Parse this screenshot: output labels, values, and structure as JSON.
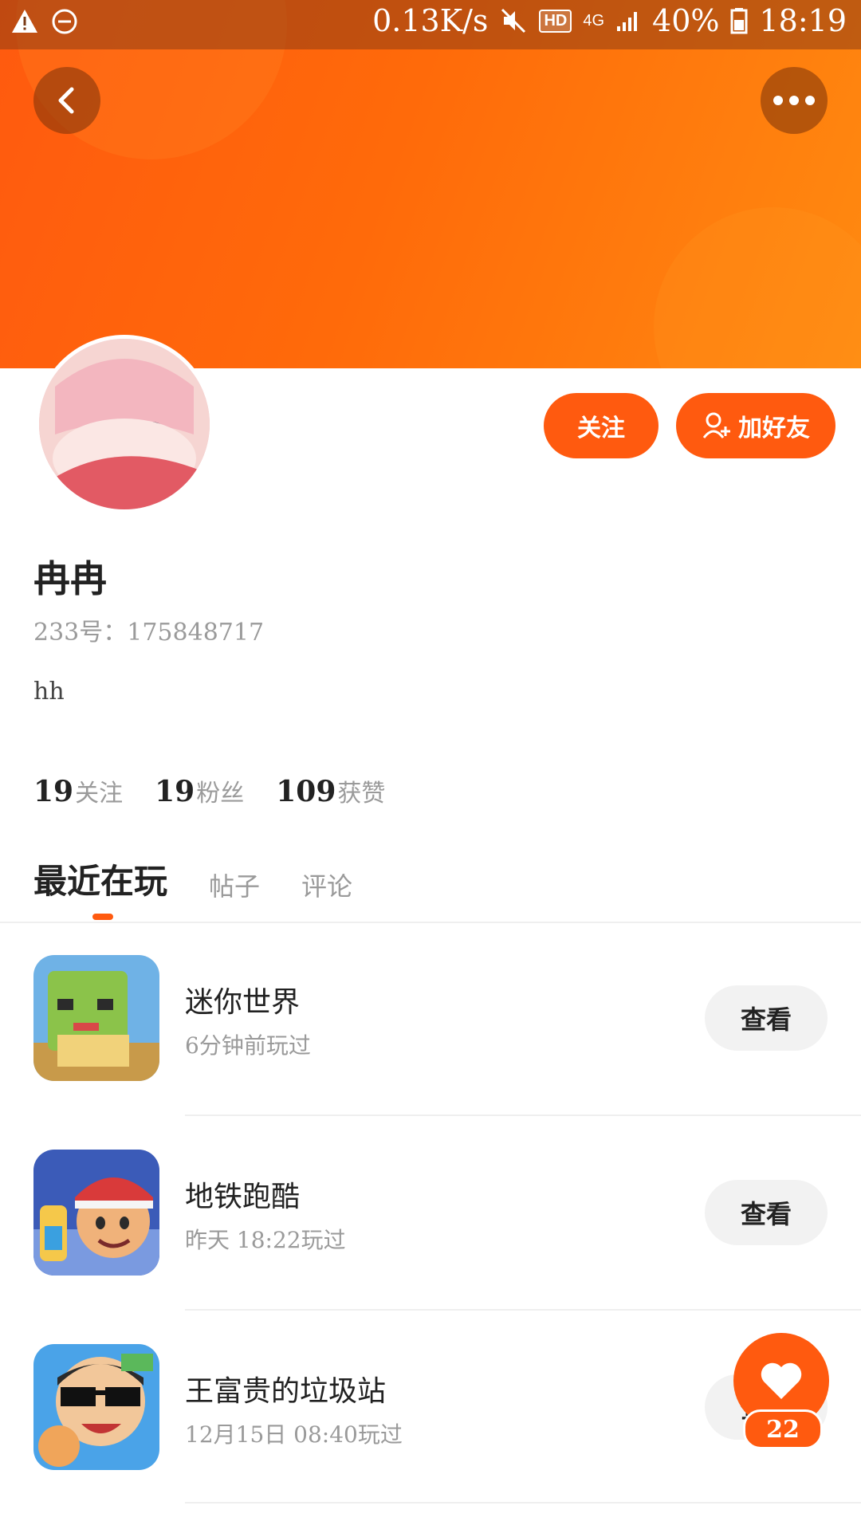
{
  "status_bar": {
    "speed": "0.13K/s",
    "hd": "HD",
    "network": "4G",
    "battery": "40%",
    "time": "18:19"
  },
  "header": {
    "back_icon": "back-arrow-icon",
    "more_icon": "more-dots-icon"
  },
  "actions": {
    "follow": "关注",
    "add_friend": "加好友"
  },
  "profile": {
    "name": "冉冉",
    "id_line": "233号：175848717",
    "bio": "hh"
  },
  "stats": [
    {
      "num": "19",
      "label": "关注"
    },
    {
      "num": "19",
      "label": "粉丝"
    },
    {
      "num": "109",
      "label": "获赞"
    }
  ],
  "tabs": [
    {
      "label": "最近在玩",
      "active": true
    },
    {
      "label": "帖子",
      "active": false
    },
    {
      "label": "评论",
      "active": false
    }
  ],
  "games": [
    {
      "name": "迷你世界",
      "time": "6分钟前玩过",
      "button": "查看"
    },
    {
      "name": "地铁跑酷",
      "time": "昨天 18:22玩过",
      "button": "查看"
    },
    {
      "name": "王富贵的垃圾站",
      "time": "12月15日 08:40玩过",
      "button": "查看"
    }
  ],
  "fab": {
    "icon": "heart-icon",
    "count": "22"
  },
  "colors": {
    "accent": "#ff5a0f",
    "muted_text": "#9a9a9a"
  }
}
